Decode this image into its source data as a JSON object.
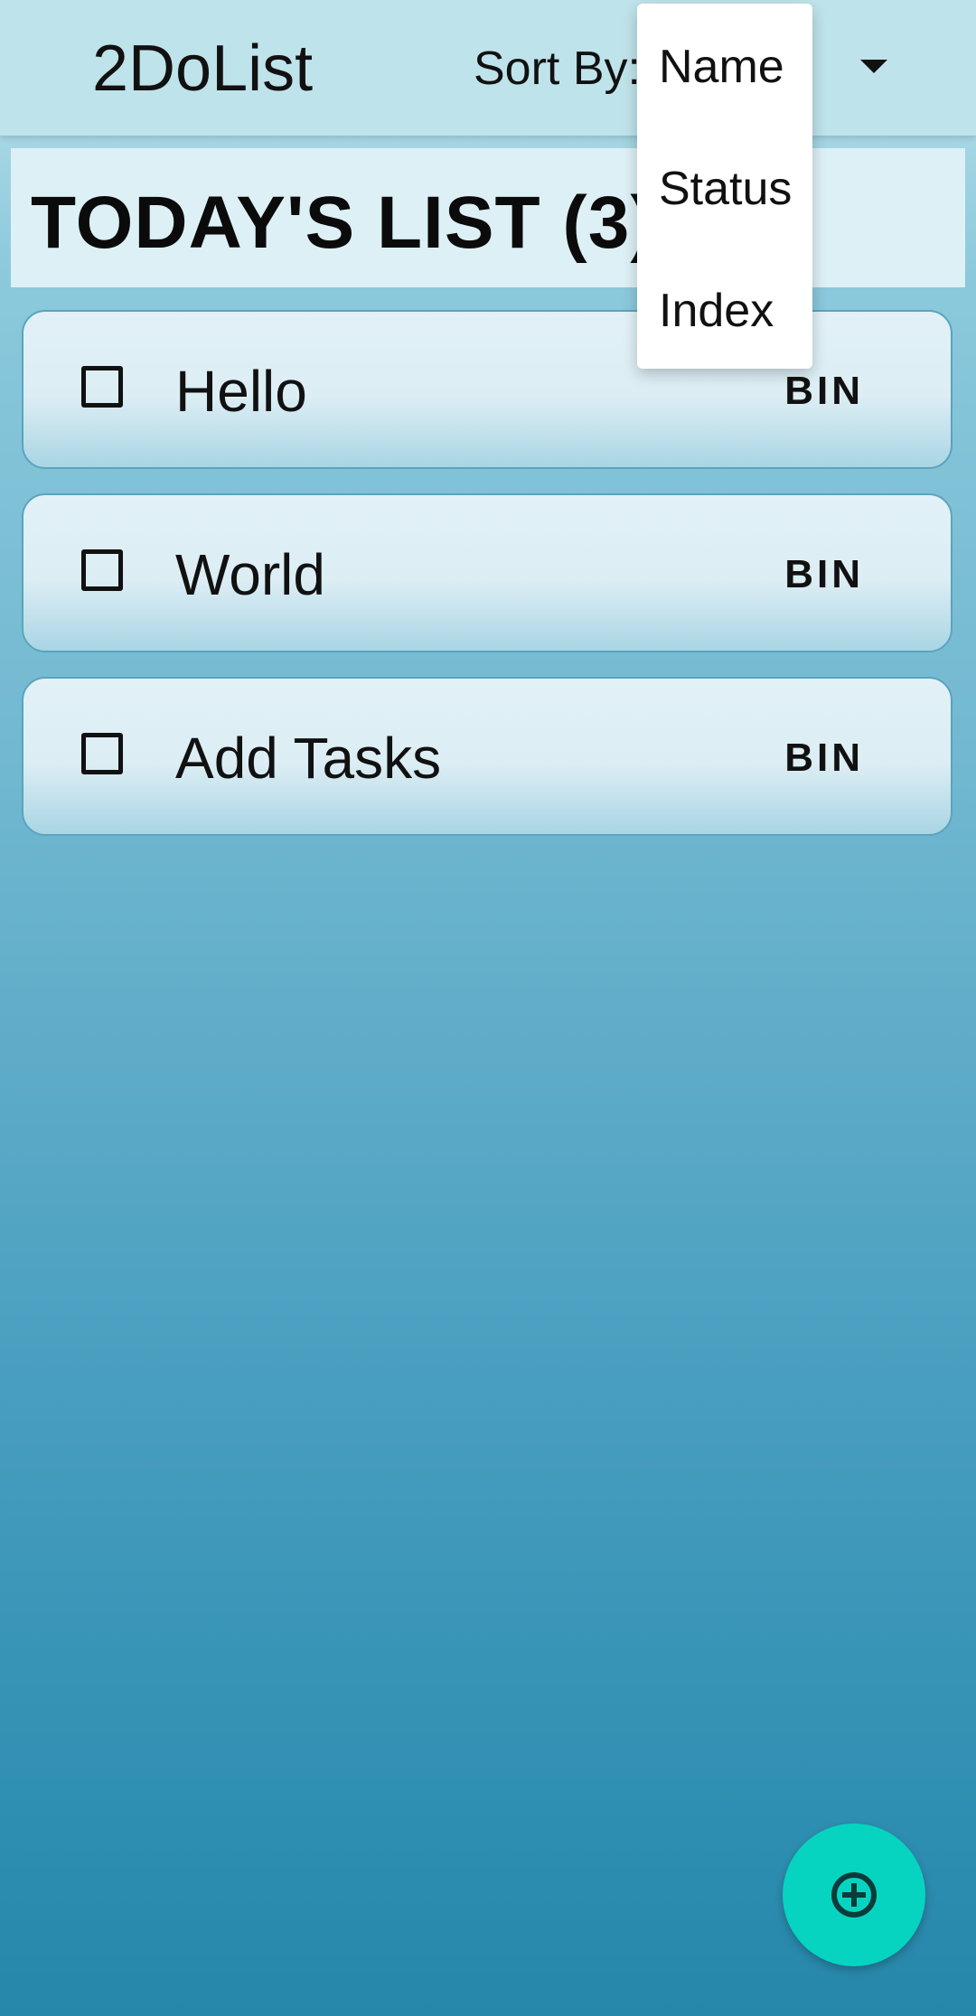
{
  "app": {
    "title": "2DoList"
  },
  "sort": {
    "label": "Sort By:",
    "menu_options": [
      "Name",
      "Status",
      "Index"
    ]
  },
  "list": {
    "header": "TODAY'S LIST (3)",
    "tasks": [
      {
        "text": "Hello",
        "checked": false,
        "action_label": "BIN"
      },
      {
        "text": "World",
        "checked": false,
        "action_label": "BIN"
      },
      {
        "text": "Add Tasks",
        "checked": false,
        "action_label": "BIN"
      }
    ]
  },
  "fab": {
    "icon": "add-circle-icon"
  },
  "colors": {
    "appbar": "#bfe3ea",
    "list_header_bg": "#ddf0f6",
    "fab": "#06d4c0",
    "background_top": "#bfe3ec",
    "background_bottom": "#2787ab"
  }
}
